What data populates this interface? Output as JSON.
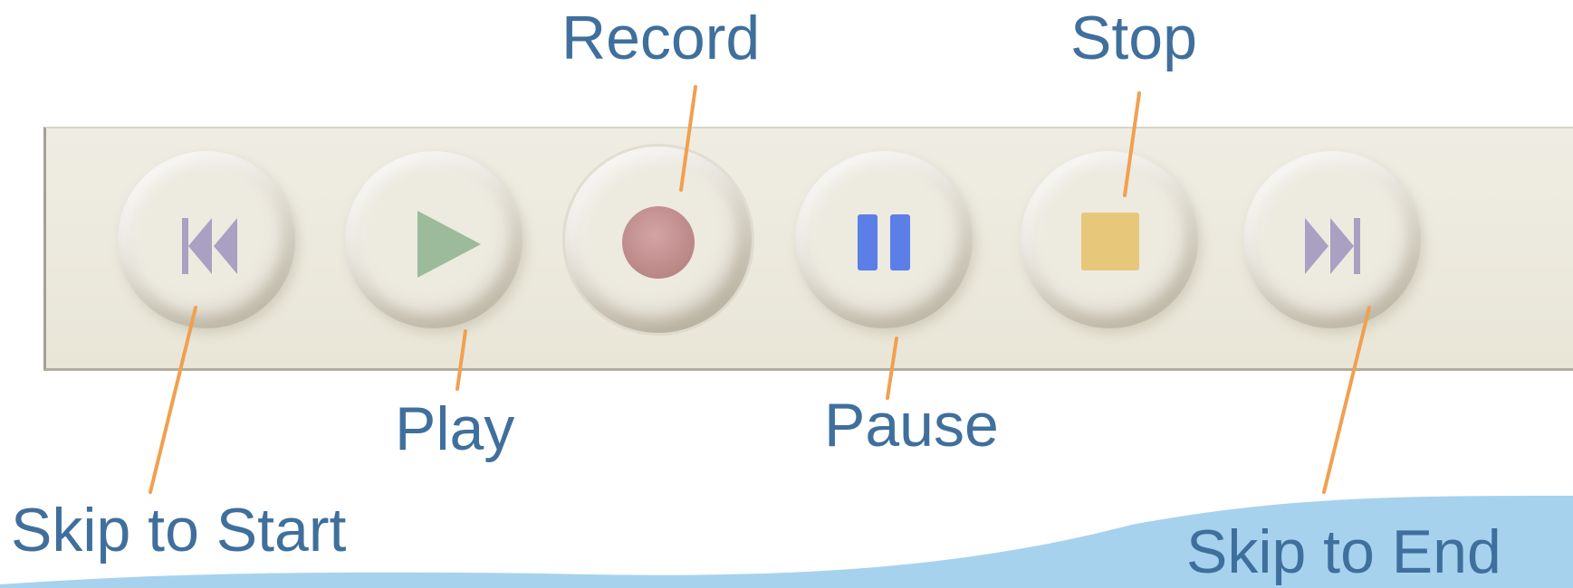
{
  "labels": {
    "record": "Record",
    "stop": "Stop",
    "play": "Play",
    "pause": "Pause",
    "skip_start": "Skip to Start",
    "skip_end": "Skip to End"
  },
  "colors": {
    "label_text": "#3f6f9c",
    "leader_line": "#f1a04f",
    "play_glyph": "#9cbb9a",
    "record_glyph": "#c79595",
    "pause_glyph": "#5b7fe6",
    "stop_glyph": "#e7c77a",
    "skip_glyph": "#a9a0c2",
    "wave": "#a6d2ee"
  },
  "buttons": [
    {
      "id": "skip-start",
      "icon": "skip-to-start-icon"
    },
    {
      "id": "play",
      "icon": "play-icon"
    },
    {
      "id": "record",
      "icon": "record-icon"
    },
    {
      "id": "pause",
      "icon": "pause-icon"
    },
    {
      "id": "stop",
      "icon": "stop-icon"
    },
    {
      "id": "skip-end",
      "icon": "skip-to-end-icon"
    }
  ]
}
